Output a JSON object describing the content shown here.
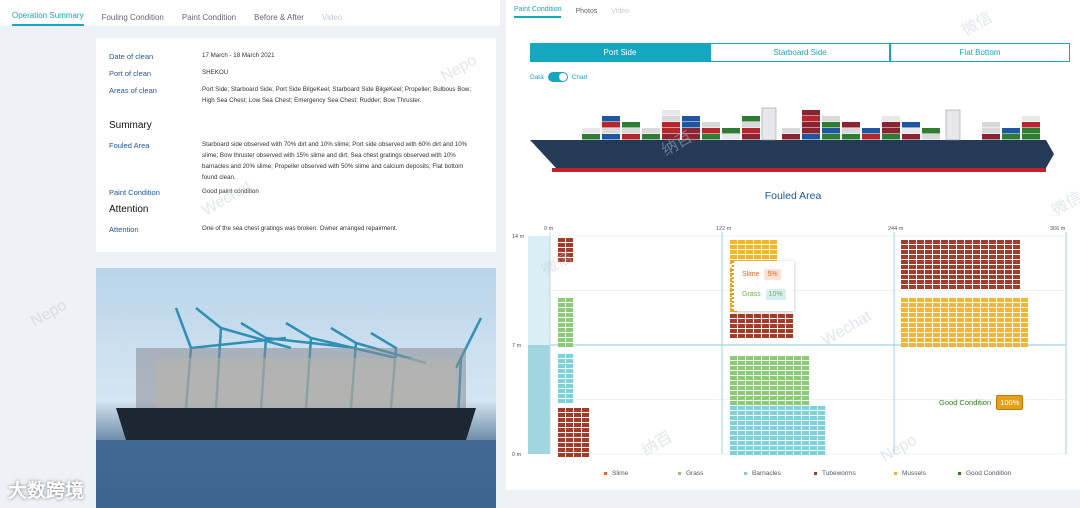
{
  "left_tabs": [
    {
      "label": "Operation Summary",
      "active": true,
      "disabled": false
    },
    {
      "label": "Fouling Condition",
      "active": false,
      "disabled": false
    },
    {
      "label": "Paint Condition",
      "active": false,
      "disabled": false
    },
    {
      "label": "Before & After",
      "active": false,
      "disabled": false
    },
    {
      "label": "Video",
      "active": false,
      "disabled": true
    }
  ],
  "right_tabs": [
    {
      "label": "Paint Condition",
      "active": true,
      "disabled": false
    },
    {
      "label": "Photos",
      "active": false,
      "disabled": false
    },
    {
      "label": "Video",
      "active": false,
      "disabled": true
    }
  ],
  "summary": {
    "date_label": "Date of clean",
    "date_value": "17 March - 18 March 2021",
    "port_label": "Port of clean",
    "port_value": "SHEKOU",
    "areas_label": "Areas of clean",
    "areas_value": "Port Side; Starboard Side; Port Side BilgeKeel; Starboard Side BilgeKeel; Propeller; Bulbous Bow; High Sea Chest; Low Sea Chest; Emergency Sea Chest; Rudder; Bow Thruster.",
    "summary_heading": "Summary",
    "fouled_label": "Fouled Area",
    "fouled_value": "Starboard side observed with 70% dirt and 10% slime; Port side observed with 60% dirt and 10% slime; Bow thruster observed with 15% slime and dirt; Sea chest gratings observed with 10% barnacles and 20% slime; Propeller observed with 50% slime and calcium deposits; Flat bottom found clean.",
    "paint_label": "Paint Condition",
    "paint_value": "Good paint condition",
    "attention_heading": "Attention",
    "attention_label": "Attention",
    "attention_value": "One of the sea chest gratings was broken. Owner arranged repairment."
  },
  "side_buttons": [
    {
      "label": "Port Side",
      "active": true
    },
    {
      "label": "Starboard Side",
      "active": false
    },
    {
      "label": "Flat Bottom",
      "active": false
    }
  ],
  "toggle": {
    "left": "Data",
    "right": "Chart",
    "value": "Chart"
  },
  "chart_data": {
    "type": "heatmap",
    "title": "Fouled Area",
    "x_ticks": [
      "0 m",
      "122 m",
      "244 m",
      "366 m"
    ],
    "y_ticks": [
      "14 m",
      "7 m",
      "0 m"
    ],
    "legend": [
      {
        "name": "Slime",
        "color": "#e8622a"
      },
      {
        "name": "Grass",
        "color": "#8cc97a"
      },
      {
        "name": "Barnacles",
        "color": "#7fd0d8"
      },
      {
        "name": "Tubeworms",
        "color": "#a23b2a"
      },
      {
        "name": "Mussels",
        "color": "#f2b52c"
      },
      {
        "name": "Good Condition",
        "color": "#2e7d1c"
      }
    ],
    "tooltip": {
      "slime_label": "Slime",
      "slime_value": "5%",
      "grass_label": "Grass",
      "grass_value": "10%"
    },
    "good_condition": {
      "label": "Good Condition",
      "value": "100%"
    }
  },
  "watermarks": [
    "微信",
    "Nepo",
    "纳百",
    "Wechat"
  ],
  "logo_text": "大数跨境"
}
